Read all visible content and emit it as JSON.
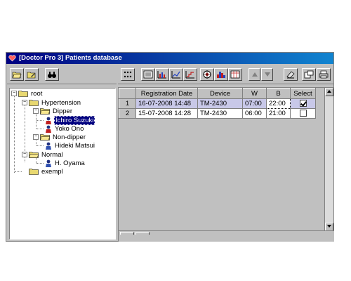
{
  "window": {
    "title": "[Doctor Pro 3] Patients database"
  },
  "left_toolbar": {
    "buttons": [
      {
        "icon": "open-folder-icon"
      },
      {
        "icon": "folder-edit-icon"
      },
      {
        "icon": "binoculars-icon"
      }
    ]
  },
  "tree": {
    "root": "root",
    "hypertension": "Hypertension",
    "dipper": "Dipper",
    "patient_1": "Ichiro Suzuki",
    "patient_2": "Yoko Ono",
    "non_dipper": "Non-dipper",
    "patient_3": "Hideki Matsui",
    "normal": "Normal",
    "patient_4": "H. Oyama",
    "exempl": "exempl",
    "expand_minus": "−"
  },
  "right_toolbar": {
    "buttons": [
      {
        "icon": "dots-grid-icon"
      },
      {
        "icon": "list-icon"
      },
      {
        "icon": "bar-chart-icon"
      },
      {
        "icon": "line-chart-icon"
      },
      {
        "icon": "step-chart-icon"
      },
      {
        "icon": "target-icon"
      },
      {
        "icon": "histogram-icon"
      },
      {
        "icon": "table-report-icon"
      },
      {
        "icon": "arrow-up-icon"
      },
      {
        "icon": "arrow-down-icon"
      },
      {
        "icon": "eraser-icon"
      },
      {
        "icon": "new-window-icon"
      },
      {
        "icon": "printer-icon"
      }
    ]
  },
  "grid": {
    "columns": [
      "Registration Date",
      "Device",
      "W",
      "B",
      "Select"
    ],
    "rows": [
      {
        "num": "1",
        "date": "16-07-2008 14:48",
        "device": "TM-2430",
        "w": "07:00",
        "b": "22:00",
        "selected": true
      },
      {
        "num": "2",
        "date": "15-07-2008 14:28",
        "device": "TM-2430",
        "w": "06:00",
        "b": "21:00",
        "selected": false
      }
    ]
  },
  "colors": {
    "titlebar": "#000080",
    "selected_row": "#c8c8e8",
    "panel": "#c0c0c0"
  }
}
